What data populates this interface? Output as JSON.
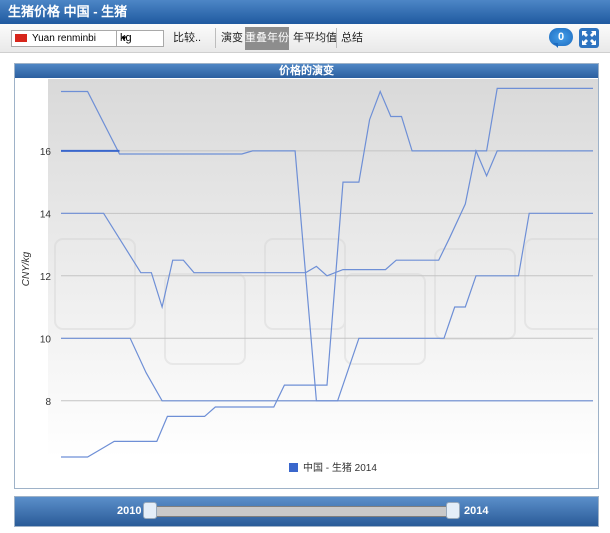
{
  "header": {
    "title": "生猪价格 中国 - 生猪"
  },
  "toolbar": {
    "currency": "Yuan renminbi",
    "unit": "kg",
    "compare": "比较..",
    "tabs": [
      "演变",
      "重叠年份",
      "年平均值",
      "总结"
    ],
    "active_tab": "重叠年份",
    "badge_count": "0"
  },
  "chart_data": {
    "type": "line",
    "title": "价格的演变",
    "ylabel": "CNY/kg",
    "ylim": [
      6.2,
      18.3
    ],
    "yticks": [
      8,
      10,
      12,
      14,
      16
    ],
    "grid": true,
    "legend_position": "bottom",
    "series": [
      {
        "name": "",
        "color": "#6e8fd6",
        "points": [
          [
            0.0,
            17.9
          ],
          [
            0.05,
            17.9
          ],
          [
            0.11,
            15.9
          ],
          [
            0.34,
            15.9
          ],
          [
            0.36,
            16.0
          ],
          [
            0.42,
            16.0
          ],
          [
            0.44,
            16.0
          ],
          [
            0.48,
            8.0
          ],
          [
            0.54,
            8.0
          ],
          [
            0.58,
            8.0
          ],
          [
            0.62,
            8.0
          ],
          [
            0.65,
            8.0
          ],
          [
            0.7,
            8.0
          ],
          [
            0.74,
            8.0
          ],
          [
            0.78,
            8.0
          ],
          [
            0.84,
            8.0
          ],
          [
            0.88,
            8.0
          ],
          [
            0.92,
            8.0
          ],
          [
            1.0,
            8.0
          ]
        ]
      },
      {
        "name": "",
        "color": "#6e8fd6",
        "points": [
          [
            0.0,
            14.0
          ],
          [
            0.08,
            14.0
          ],
          [
            0.15,
            12.1
          ],
          [
            0.17,
            12.1
          ],
          [
            0.19,
            11.0
          ],
          [
            0.21,
            12.5
          ],
          [
            0.23,
            12.5
          ],
          [
            0.25,
            12.1
          ],
          [
            0.3,
            12.1
          ],
          [
            0.4,
            12.1
          ],
          [
            0.46,
            12.1
          ],
          [
            0.48,
            12.3
          ],
          [
            0.5,
            12.0
          ],
          [
            0.53,
            12.2
          ],
          [
            0.57,
            12.2
          ],
          [
            0.61,
            12.2
          ],
          [
            0.63,
            12.5
          ],
          [
            0.66,
            12.5
          ],
          [
            0.71,
            12.5
          ],
          [
            0.73,
            13.2
          ],
          [
            0.76,
            14.3
          ],
          [
            0.78,
            16.0
          ],
          [
            0.8,
            15.2
          ],
          [
            0.82,
            16.0
          ],
          [
            1.0,
            16.0
          ]
        ]
      },
      {
        "name": "",
        "color": "#6e8fd6",
        "points": [
          [
            0.0,
            10.0
          ],
          [
            0.13,
            10.0
          ],
          [
            0.16,
            8.9
          ],
          [
            0.19,
            8.0
          ],
          [
            0.27,
            8.0
          ],
          [
            0.31,
            8.0
          ],
          [
            0.36,
            8.0
          ],
          [
            0.4,
            8.0
          ],
          [
            0.44,
            8.0
          ],
          [
            0.49,
            8.0
          ],
          [
            0.52,
            8.0
          ],
          [
            0.56,
            10.0
          ],
          [
            0.6,
            10.0
          ],
          [
            0.62,
            10.0
          ],
          [
            0.64,
            10.0
          ],
          [
            0.67,
            10.0
          ],
          [
            0.7,
            10.0
          ],
          [
            0.72,
            10.0
          ],
          [
            0.74,
            11.0
          ],
          [
            0.76,
            11.0
          ],
          [
            0.78,
            12.0
          ],
          [
            0.8,
            12.0
          ],
          [
            0.84,
            12.0
          ],
          [
            0.86,
            12.0
          ],
          [
            0.88,
            14.0
          ],
          [
            0.92,
            14.0
          ],
          [
            1.0,
            14.0
          ]
        ]
      },
      {
        "name": "",
        "color": "#6e8fd6",
        "points": [
          [
            0.0,
            6.2
          ],
          [
            0.05,
            6.2
          ],
          [
            0.08,
            6.5
          ],
          [
            0.1,
            6.7
          ],
          [
            0.15,
            6.7
          ],
          [
            0.18,
            6.7
          ],
          [
            0.2,
            7.5
          ],
          [
            0.23,
            7.5
          ],
          [
            0.27,
            7.5
          ],
          [
            0.29,
            7.8
          ],
          [
            0.33,
            7.8
          ],
          [
            0.37,
            7.8
          ],
          [
            0.4,
            7.8
          ],
          [
            0.42,
            8.5
          ],
          [
            0.46,
            8.5
          ],
          [
            0.48,
            8.5
          ],
          [
            0.49,
            8.5
          ],
          [
            0.5,
            8.5
          ],
          [
            0.53,
            15.0
          ],
          [
            0.56,
            15.0
          ],
          [
            0.58,
            17.0
          ],
          [
            0.6,
            17.9
          ],
          [
            0.62,
            17.1
          ],
          [
            0.64,
            17.1
          ],
          [
            0.66,
            16.0
          ],
          [
            0.7,
            16.0
          ],
          [
            0.72,
            16.0
          ],
          [
            0.74,
            16.0
          ],
          [
            0.76,
            16.0
          ],
          [
            0.78,
            16.0
          ],
          [
            0.8,
            16.0
          ],
          [
            0.82,
            18.0
          ],
          [
            1.0,
            18.0
          ]
        ]
      },
      {
        "name": "中国 - 生猪 2014",
        "color": "#3a67cc",
        "points": [
          [
            0.0,
            16.0
          ],
          [
            0.11,
            16.0
          ]
        ]
      }
    ],
    "legend": [
      "中国 - 生猪 2014"
    ]
  },
  "slider": {
    "start": "2010",
    "end": "2014"
  }
}
